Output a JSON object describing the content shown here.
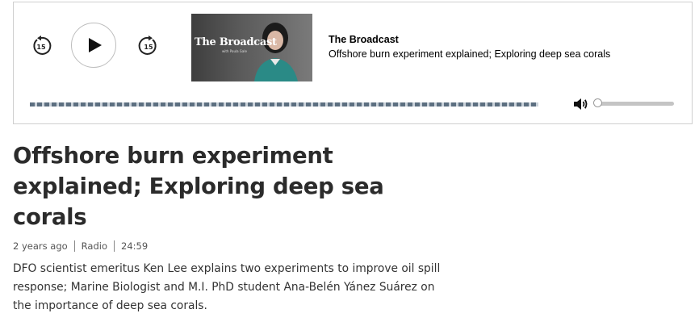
{
  "player": {
    "skip_back_seconds": "15",
    "skip_forward_seconds": "15",
    "thumbnail": {
      "title": "The Broadcast",
      "subtitle": "with Paula Gale"
    },
    "now_playing": {
      "show": "The Broadcast",
      "episode": "Offshore burn experiment explained; Exploring deep sea corals"
    },
    "progress_fraction": 0,
    "volume_fraction": 0
  },
  "article": {
    "headline": "Offshore burn experiment explained; Exploring deep sea corals",
    "meta": {
      "age": "2 years ago",
      "type": "Radio",
      "duration": "24:59"
    },
    "description": "DFO scientist emeritus Ken Lee explains two experiments to improve oil spill response; Marine Biologist and M.I. PhD student Ana-Belén Yánez Suárez on the importance of deep sea corals."
  }
}
